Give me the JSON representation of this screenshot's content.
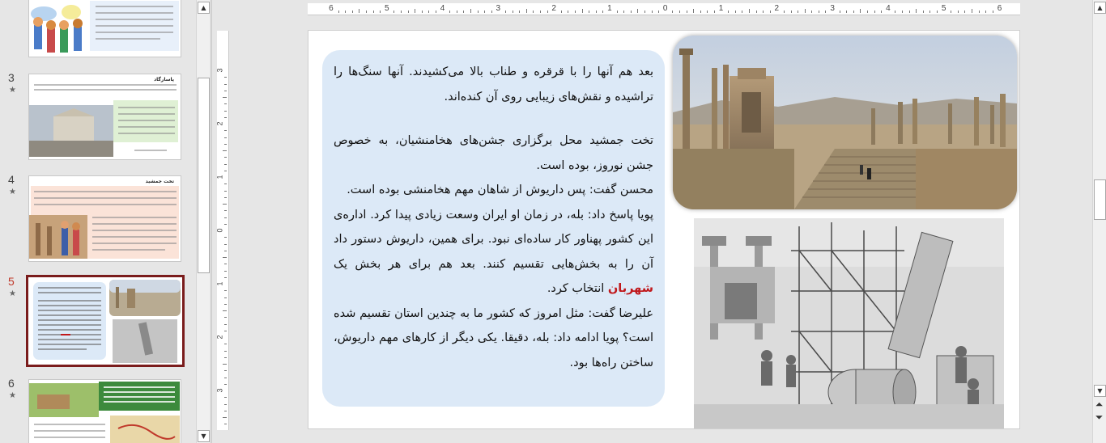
{
  "thumbnails": [
    {
      "number": "",
      "star": ""
    },
    {
      "number": "3",
      "star": "★",
      "title": "پاسارگاد"
    },
    {
      "number": "4",
      "star": "★",
      "title": "تخت جمشید"
    },
    {
      "number": "5",
      "star": "★"
    },
    {
      "number": "6",
      "star": "★"
    }
  ],
  "scroll_icons": {
    "up": "▲",
    "down": "▼",
    "prev_slide": "⏶",
    "next_slide": "⏷"
  },
  "ruler": {
    "h_labels": [
      "6",
      "5",
      "4",
      "3",
      "2",
      "1",
      "0",
      "1",
      "2",
      "3",
      "4",
      "5",
      "6"
    ],
    "v_labels": [
      "3",
      "2",
      "1",
      "0",
      "1",
      "2",
      "3"
    ]
  },
  "slide": {
    "paragraph1": "بعد هم آنها را با قرقره و طناب بالا می‌کشیدند. آنها سنگ‌ها را تراشیده و نقش‌های زیبایی روی آن کنده‌اند.",
    "paragraph2": "تخت جمشید محل برگزاری جشن‌های هخامنشیان، به خصوص جشن نوروز، بوده است.",
    "paragraph3": "محسن گفت: پس داریوش از شاهان مهم هخامنشی بوده است.",
    "paragraph4_before": "پویا پاسخ داد: بله، در زمان او ایران وسعت زیادی پیدا کرد. اداره‌ی این کشور پهناور کار ساده‌ای نبود. برای همین، داریوش دستور داد آن را به بخش‌هایی تقسیم کنند. بعد هم برای هر بخش یک",
    "paragraph4_highlight": "شهربان",
    "paragraph4_after": "انتخاب کرد.",
    "paragraph5": "علیرضا گفت: مثل امروز که کشور ما به چندین استان تقسیم شده است؟ پویا ادامه داد: بله، دقیقا. یکی دیگر از کارهای مهم داریوش، ساختن راه‌ها بود."
  },
  "colors": {
    "text_box_bg": "#dce9f7",
    "highlight_red": "#c0181c",
    "selected_thumb_border": "#7a1c1c",
    "active_slide_number": "#c0392b"
  }
}
